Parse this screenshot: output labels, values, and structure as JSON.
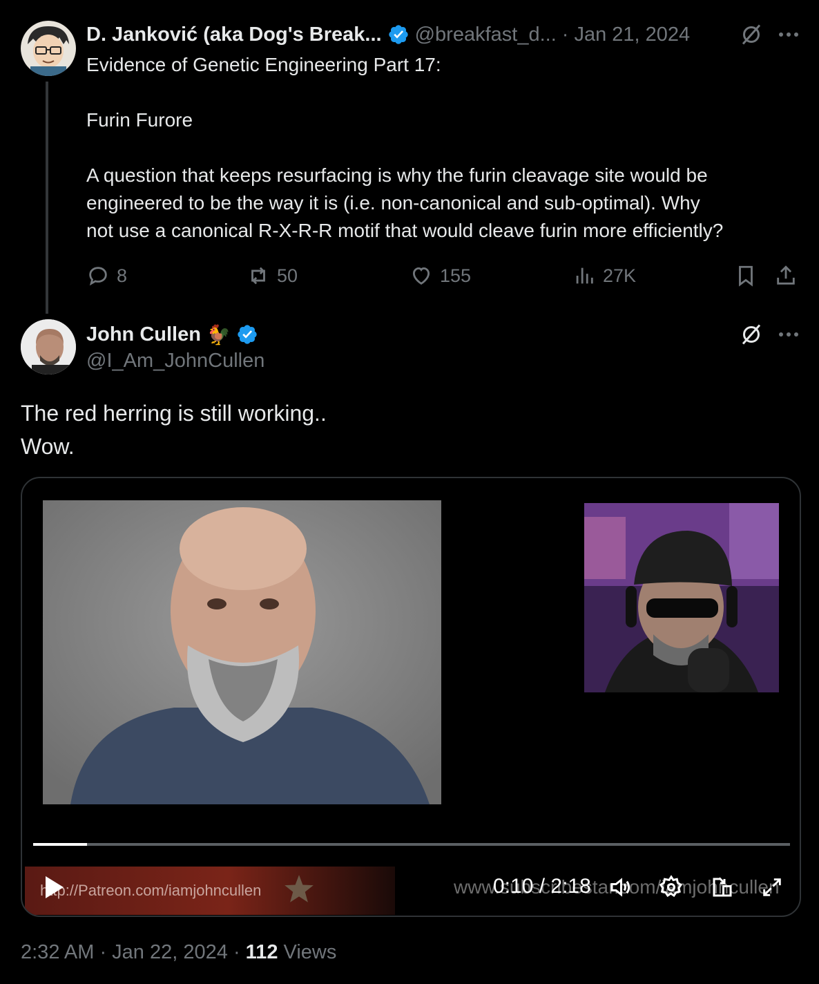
{
  "parent_tweet": {
    "display_name": "D. Janković (aka Dog's Break...",
    "handle": "@breakfast_d...",
    "date": "· Jan 21, 2024",
    "text": "Evidence of Genetic Engineering Part 17:\n\nFurin Furore\n\nA question that keeps resurfacing is why the furin cleavage site would be\nengineered to be the way it is (i.e. non-canonical and sub-optimal). Why\nnot use a canonical R-X-R-R motif that would cleave furin more efficiently?",
    "stats": {
      "replies": "8",
      "reposts": "50",
      "likes": "155",
      "views": "27K"
    }
  },
  "main_tweet": {
    "display_name": "John Cullen",
    "emoji": "🐓",
    "handle": "@I_Am_JohnCullen",
    "text": "The red herring is still working..\nWow.",
    "video": {
      "time": "0:10 / 2:18",
      "progress_fraction": 0.071,
      "banner_text": "http://Patreon.com/iamjohncullen",
      "watermark_text": "www.subscribestar.com/iamjohncullen"
    },
    "footer": {
      "time": "2:32 AM",
      "date": "· Jan 22, 2024 ·",
      "views_count": "112",
      "views_label": "Views"
    }
  },
  "icons": {
    "verified": "verified-badge-icon",
    "grok": "grok-icon",
    "more": "more-icon",
    "reply": "reply-icon",
    "repost": "repost-icon",
    "like": "like-icon",
    "views": "views-icon",
    "bookmark": "bookmark-icon",
    "share": "share-icon"
  },
  "colors": {
    "background": "#000000",
    "text": "#e7e9ea",
    "muted": "#71767b",
    "verified": "#1d9bf0"
  }
}
